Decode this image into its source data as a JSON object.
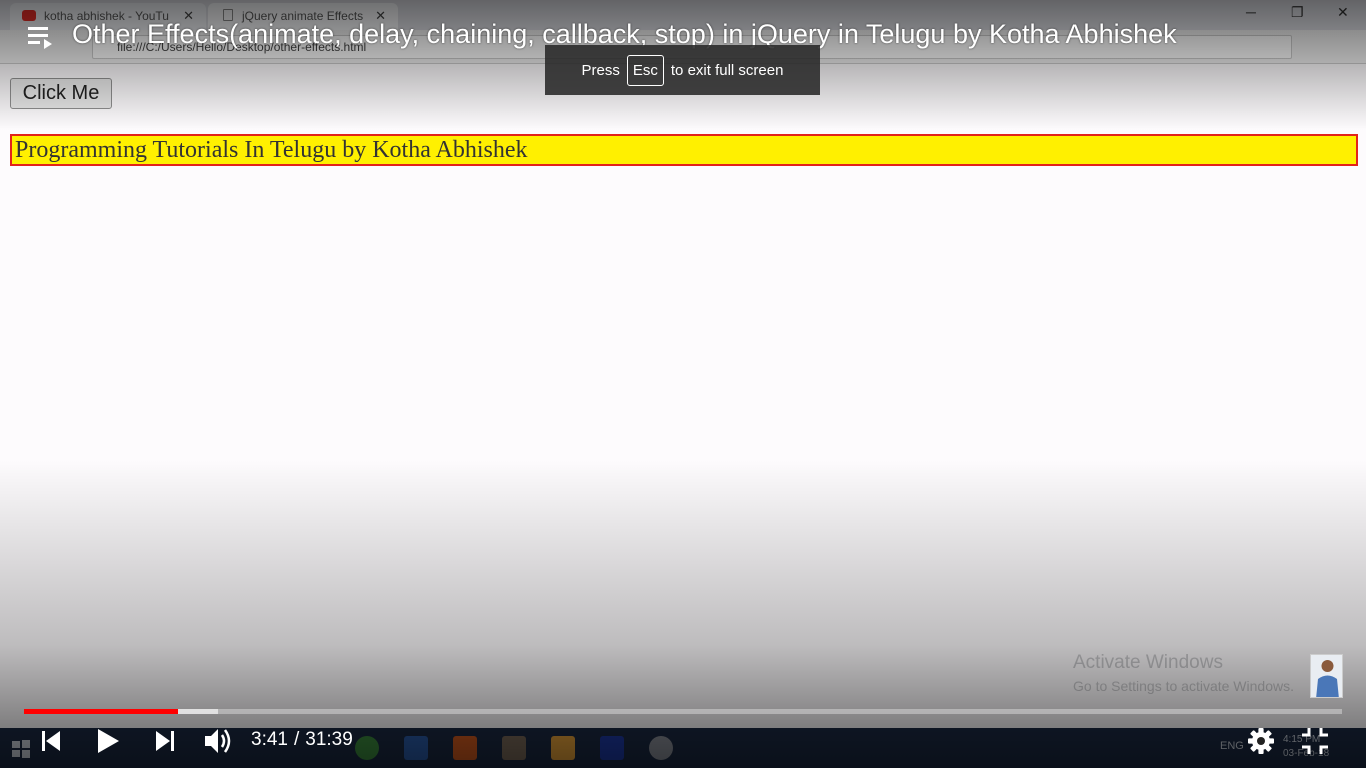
{
  "browser": {
    "tabs": [
      {
        "label": "kotha abhishek - YouTu",
        "close": "✕"
      },
      {
        "label": "jQuery animate Effects",
        "close": "✕"
      }
    ],
    "window_controls": {
      "minimize": "─",
      "restore": "❐",
      "close": "✕"
    },
    "address": "file:///C:/Users/Hello/Desktop/other-effects.html"
  },
  "page": {
    "button_label": "Click Me",
    "banner_text": "Programming Tutorials In Telugu by Kotha Abhishek"
  },
  "windows_watermark": {
    "line1": "Activate Windows",
    "line2": "Go to Settings to activate Windows."
  },
  "taskbar": {
    "language": "ENG",
    "time": "4:15 PM",
    "date": "03-Feb-18"
  },
  "player": {
    "title": "Other Effects(animate, delay, chaining, callback, stop) in jQuery in Telugu by Kotha Abhishek",
    "fullscreen_toast": {
      "press": "Press",
      "key": "Esc",
      "suffix": "to exit full screen"
    },
    "current_time": "3:41",
    "separator": "/",
    "duration": "31:39",
    "progress_played": 0.117,
    "progress_buffered": 0.147,
    "accent_color": "#ff0000",
    "icons": [
      "playlist-icon",
      "previous-icon",
      "play-icon",
      "next-icon",
      "volume-icon",
      "settings-icon",
      "exit-fullscreen-icon"
    ]
  }
}
